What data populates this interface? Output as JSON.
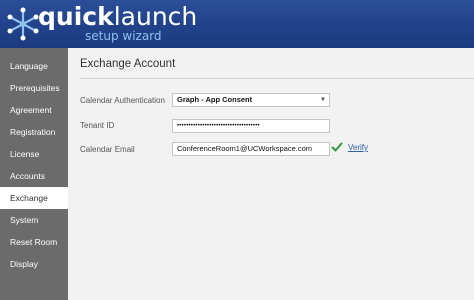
{
  "header": {
    "brand_quick": "quick",
    "brand_launch": "launch",
    "tagline": "setup wizard"
  },
  "sidebar": {
    "items": [
      {
        "label": "Language",
        "active": false
      },
      {
        "label": "Prerequisites",
        "active": false
      },
      {
        "label": "Agreement",
        "active": false
      },
      {
        "label": "Registration",
        "active": false
      },
      {
        "label": "License",
        "active": false
      },
      {
        "label": "Accounts",
        "active": false
      },
      {
        "label": "Exchange",
        "active": true
      },
      {
        "label": "System",
        "active": false
      },
      {
        "label": "Reset Room",
        "active": false
      },
      {
        "label": "Display",
        "active": false
      }
    ]
  },
  "main": {
    "title": "Exchange Account",
    "calendar_auth_label": "Calendar Authentication",
    "calendar_auth_value": "Graph - App Consent",
    "tenant_label": "Tenant ID",
    "tenant_value": "••••••••••••••••••••••••••••••••••••",
    "email_label": "Calendar Email",
    "email_value": "ConferenceRoom1@UCWorkspace.com",
    "verify_label": "Verify"
  },
  "colors": {
    "header": "#21428a",
    "sidebar": "#6b6b6b",
    "accent": "#8fc2ee",
    "check": "#2e9a3a",
    "link": "#2c5ea8"
  }
}
